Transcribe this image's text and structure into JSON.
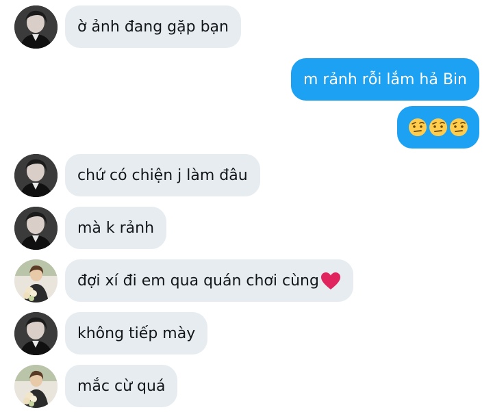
{
  "messages": [
    {
      "side": "in",
      "avatar": "boy",
      "text": "ờ ảnh đang gặp bạn"
    },
    {
      "side": "out",
      "text": "m rảnh rỗi lắm hả Bin"
    },
    {
      "side": "out",
      "emoji": [
        "🤨",
        "🤨",
        "🤨"
      ]
    },
    {
      "side": "in",
      "avatar": "boy",
      "text": "chứ có chiện j làm đâu"
    },
    {
      "side": "in",
      "avatar": "boy",
      "text": "mà k rảnh"
    },
    {
      "side": "in",
      "avatar": "girl",
      "text": "đợi xí đi em qua quán chơi cùng",
      "trailing_emoji": "❤️"
    },
    {
      "side": "in",
      "avatar": "boy",
      "text": "không tiếp mày"
    },
    {
      "side": "in",
      "avatar": "girl",
      "text": "mắc cừ quá"
    }
  ],
  "colors": {
    "incoming_bubble": "#e6ecf0",
    "outgoing_bubble": "#1da1f2",
    "incoming_text": "#14171a",
    "outgoing_text": "#ffffff",
    "heart": "#e0245e"
  }
}
